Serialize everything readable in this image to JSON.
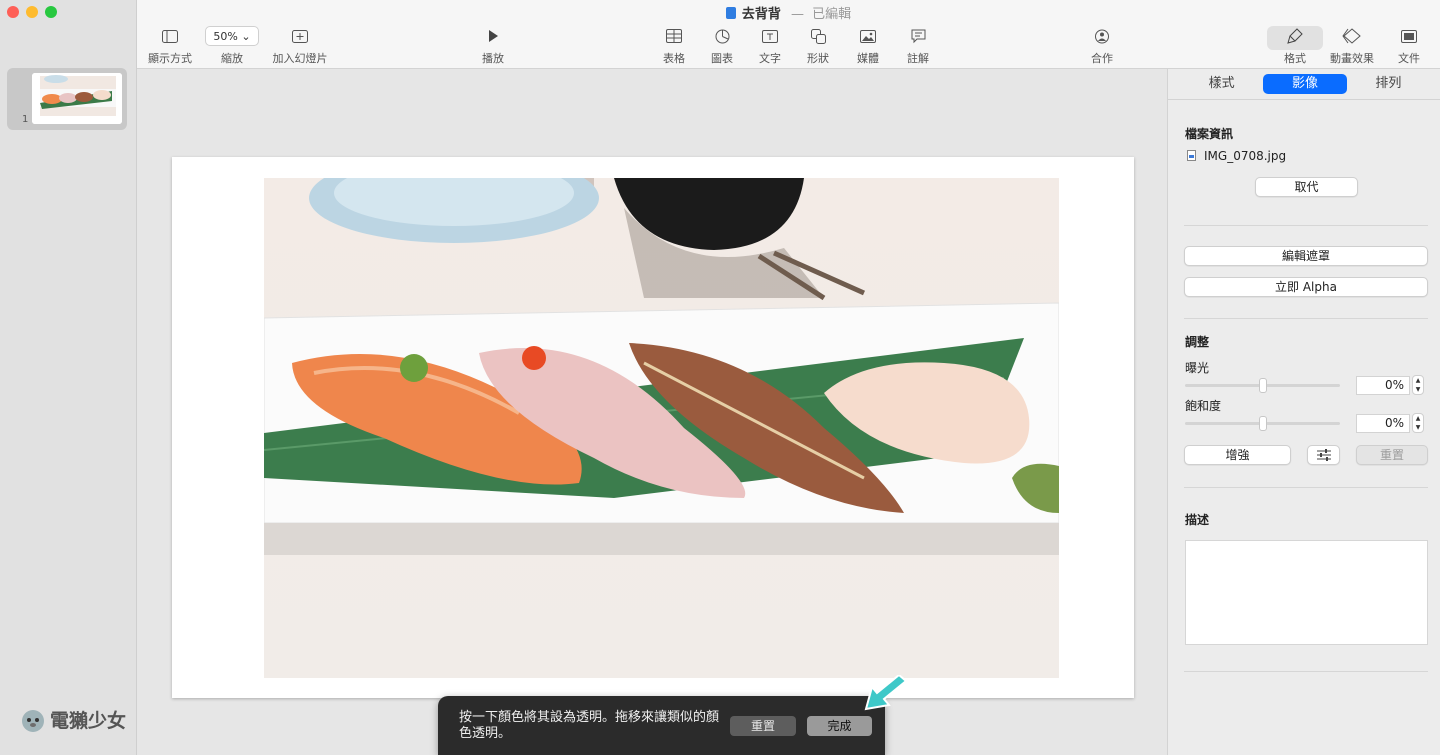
{
  "window": {
    "title": "去背背",
    "separator": "—",
    "status": "已編輯"
  },
  "toolbar": {
    "view_label": "顯示方式",
    "zoom_value": "50% ⌄",
    "zoom_label": "縮放",
    "add_slide_label": "加入幻燈片",
    "play_label": "播放",
    "table_label": "表格",
    "chart_label": "圖表",
    "text_label": "文字",
    "shape_label": "形狀",
    "media_label": "媒體",
    "comment_label": "註解",
    "collaborate_label": "合作",
    "format_label": "格式",
    "animate_label": "動畫效果",
    "document_label": "文件"
  },
  "sidebar": {
    "slides": [
      {
        "number": "1"
      }
    ]
  },
  "hud": {
    "instruction": "按一下顏色將其設為透明。拖移來讓類似的顏色透明。",
    "reset_label": "重置",
    "done_label": "完成"
  },
  "watermark": {
    "text": "電獺少女"
  },
  "inspector": {
    "tabs": [
      {
        "label": "樣式",
        "active": false
      },
      {
        "label": "影像",
        "active": true
      },
      {
        "label": "排列",
        "active": false
      }
    ],
    "file_info_heading": "檔案資訊",
    "file_name": "IMG_0708.jpg",
    "replace_label": "取代",
    "edit_mask_label": "編輯遮罩",
    "instant_alpha_label": "立即 Alpha",
    "adjust_heading": "調整",
    "exposure_label": "曝光",
    "exposure_value": "0%",
    "saturation_label": "飽和度",
    "saturation_value": "0%",
    "enhance_label": "增強",
    "reset_label": "重置",
    "description_heading": "描述"
  },
  "colors": {
    "accent": "#0a6cff",
    "hud_background": "#2b2b2b",
    "arrow": "#3ec8c8"
  }
}
